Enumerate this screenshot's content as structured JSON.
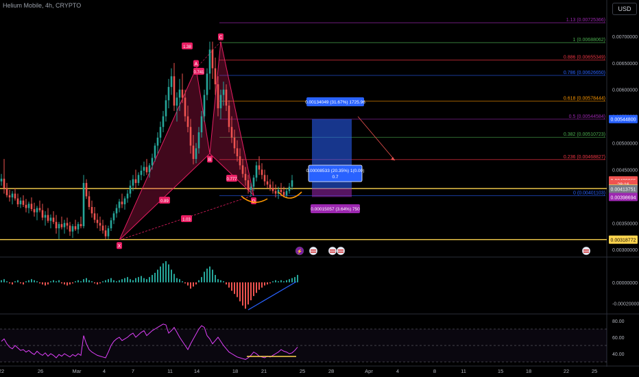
{
  "header": {
    "title": "Helium Mobile, 4h, CRYPTO",
    "currency_button": "USD"
  },
  "colors": {
    "bg": "#000000",
    "up": "#26a69a",
    "down": "#ef5350",
    "pattern": "#e91e63",
    "yellow": "#ffd54f",
    "rsi": "#e040fb",
    "blue": "#2962ff",
    "purple": "#9c27b0"
  },
  "chart_data": [
    {
      "type": "candlestick",
      "title": "Helium Mobile, 4h, CRYPTO",
      "x_ticks": [
        "22",
        "26",
        "Mar",
        "4",
        "7",
        "11",
        "14",
        "18",
        "21",
        "25",
        "28",
        "Apr",
        "4",
        "8",
        "11",
        "15",
        "18",
        "22",
        "25"
      ],
      "y_ticks": [
        "0.00700000",
        "0.00650000",
        "0.00600000",
        "0.00550000",
        "0.00500000",
        "0.00450000",
        "0.00400000",
        "0.00350000",
        "0.00300000"
      ],
      "ylim": [
        0.0029,
        0.0075
      ],
      "candles": [
        [
          0.00428,
          0.00442,
          0.0042,
          0.00433
        ],
        [
          0.00433,
          0.0047,
          0.00405,
          0.00415
        ],
        [
          0.00415,
          0.00425,
          0.00398,
          0.00402
        ],
        [
          0.00402,
          0.00412,
          0.0039,
          0.00398
        ],
        [
          0.00398,
          0.0041,
          0.00385,
          0.00405
        ],
        [
          0.00405,
          0.00415,
          0.00392,
          0.00396
        ],
        [
          0.00396,
          0.00405,
          0.0038,
          0.00385
        ],
        [
          0.00385,
          0.00398,
          0.00378,
          0.00392
        ],
        [
          0.00392,
          0.00402,
          0.0038,
          0.00384
        ],
        [
          0.00384,
          0.00395,
          0.0037,
          0.00378
        ],
        [
          0.00378,
          0.0039,
          0.00368,
          0.00386
        ],
        [
          0.00386,
          0.00398,
          0.00372,
          0.00376
        ],
        [
          0.00376,
          0.00388,
          0.00362,
          0.0037
        ],
        [
          0.0037,
          0.00382,
          0.00355,
          0.00378
        ],
        [
          0.00378,
          0.00392,
          0.0037,
          0.00374
        ],
        [
          0.00374,
          0.00386,
          0.00355,
          0.0036
        ],
        [
          0.0036,
          0.00372,
          0.00345,
          0.00365
        ],
        [
          0.00365,
          0.00378,
          0.0035,
          0.00354
        ],
        [
          0.00354,
          0.00366,
          0.0034,
          0.0036
        ],
        [
          0.0036,
          0.00372,
          0.00348,
          0.00352
        ],
        [
          0.00352,
          0.00365,
          0.0033,
          0.0034
        ],
        [
          0.0034,
          0.00352,
          0.0032,
          0.00348
        ],
        [
          0.00348,
          0.00362,
          0.00338,
          0.00342
        ],
        [
          0.00342,
          0.00356,
          0.0033,
          0.0035
        ],
        [
          0.0035,
          0.0036,
          0.00338,
          0.00345
        ],
        [
          0.00345,
          0.00352,
          0.00326,
          0.00334
        ],
        [
          0.00334,
          0.00348,
          0.00322,
          0.00344
        ],
        [
          0.00344,
          0.00356,
          0.00335,
          0.00338
        ],
        [
          0.00338,
          0.00352,
          0.0033,
          0.00348
        ],
        [
          0.00348,
          0.00362,
          0.0034,
          0.00344
        ],
        [
          0.00344,
          0.0044,
          0.0034,
          0.00425
        ],
        [
          0.00425,
          0.00432,
          0.00395,
          0.004
        ],
        [
          0.004,
          0.0041,
          0.00375,
          0.0038
        ],
        [
          0.0038,
          0.00392,
          0.0036,
          0.00368
        ],
        [
          0.00368,
          0.0038,
          0.0035,
          0.00356
        ],
        [
          0.00356,
          0.00368,
          0.0034,
          0.0035
        ],
        [
          0.0035,
          0.00362,
          0.00335,
          0.00345
        ],
        [
          0.00345,
          0.00356,
          0.0033,
          0.00336
        ],
        [
          0.00336,
          0.00346,
          0.0032,
          0.00325
        ],
        [
          0.00325,
          0.00345,
          0.0032,
          0.0034
        ],
        [
          0.0034,
          0.0036,
          0.00335,
          0.00355
        ],
        [
          0.00355,
          0.00372,
          0.00348,
          0.00368
        ],
        [
          0.00368,
          0.00385,
          0.0036,
          0.00378
        ],
        [
          0.00378,
          0.00395,
          0.0037,
          0.0039
        ],
        [
          0.0039,
          0.00405,
          0.00378,
          0.00385
        ],
        [
          0.00385,
          0.004,
          0.00375,
          0.00396
        ],
        [
          0.00396,
          0.00412,
          0.00388,
          0.00405
        ],
        [
          0.00405,
          0.0043,
          0.00398,
          0.0042
        ],
        [
          0.0042,
          0.0044,
          0.0041,
          0.00432
        ],
        [
          0.00432,
          0.0045,
          0.00415,
          0.00425
        ],
        [
          0.00425,
          0.00445,
          0.0042,
          0.0044
        ],
        [
          0.0044,
          0.00458,
          0.0043,
          0.00448
        ],
        [
          0.00448,
          0.00465,
          0.00438,
          0.00455
        ],
        [
          0.00455,
          0.0047,
          0.0044,
          0.00445
        ],
        [
          0.00445,
          0.00462,
          0.00435,
          0.00458
        ],
        [
          0.00458,
          0.0048,
          0.0045,
          0.00472
        ],
        [
          0.00472,
          0.005,
          0.00465,
          0.00495
        ],
        [
          0.00495,
          0.0052,
          0.0048,
          0.0051
        ],
        [
          0.0051,
          0.0054,
          0.005,
          0.0053
        ],
        [
          0.0053,
          0.0056,
          0.0052,
          0.0055
        ],
        [
          0.0055,
          0.0059,
          0.0054,
          0.0058
        ],
        [
          0.0058,
          0.0062,
          0.00565,
          0.00605
        ],
        [
          0.00605,
          0.0064,
          0.0059,
          0.00625
        ],
        [
          0.00625,
          0.0065,
          0.0056,
          0.0057
        ],
        [
          0.0057,
          0.00595,
          0.0054,
          0.00585
        ],
        [
          0.00585,
          0.0062,
          0.0056,
          0.006
        ],
        [
          0.006,
          0.0063,
          0.00575,
          0.00585
        ],
        [
          0.00585,
          0.006,
          0.0054,
          0.0055
        ],
        [
          0.0055,
          0.0057,
          0.0052,
          0.0053
        ],
        [
          0.0053,
          0.00545,
          0.0048,
          0.00495
        ],
        [
          0.00495,
          0.00515,
          0.0046,
          0.0047
        ],
        [
          0.0047,
          0.005,
          0.00462,
          0.0049
        ],
        [
          0.0049,
          0.0053,
          0.0048,
          0.0052
        ],
        [
          0.0052,
          0.0056,
          0.0051,
          0.0055
        ],
        [
          0.0055,
          0.006,
          0.0054,
          0.0059
        ],
        [
          0.0059,
          0.0064,
          0.0058,
          0.0063
        ],
        [
          0.0063,
          0.0069,
          0.006,
          0.00675
        ],
        [
          0.00675,
          0.0069,
          0.0062,
          0.0064
        ],
        [
          0.0064,
          0.0066,
          0.0059,
          0.0061
        ],
        [
          0.0061,
          0.00625,
          0.0055,
          0.00565
        ],
        [
          0.00565,
          0.006,
          0.00545,
          0.0059
        ],
        [
          0.0059,
          0.00615,
          0.0057,
          0.006
        ],
        [
          0.006,
          0.0061,
          0.0056,
          0.0057
        ],
        [
          0.0057,
          0.0058,
          0.0052,
          0.0053
        ],
        [
          0.0053,
          0.0055,
          0.005,
          0.0051
        ],
        [
          0.0051,
          0.00525,
          0.0048,
          0.0049
        ],
        [
          0.0049,
          0.00505,
          0.00465,
          0.00475
        ],
        [
          0.00475,
          0.0049,
          0.0045,
          0.00458
        ],
        [
          0.00458,
          0.0047,
          0.00435,
          0.00442
        ],
        [
          0.00442,
          0.00455,
          0.0042,
          0.0043
        ],
        [
          0.0043,
          0.0044,
          0.00405,
          0.00412
        ],
        [
          0.00412,
          0.00425,
          0.004,
          0.00418
        ],
        [
          0.00418,
          0.0044,
          0.0041,
          0.00435
        ],
        [
          0.00435,
          0.00465,
          0.00428,
          0.00458
        ],
        [
          0.00458,
          0.00475,
          0.0044,
          0.0045
        ],
        [
          0.0045,
          0.00462,
          0.00432,
          0.0044
        ],
        [
          0.0044,
          0.0045,
          0.0042,
          0.00428
        ],
        [
          0.00428,
          0.0044,
          0.00415,
          0.00422
        ],
        [
          0.00422,
          0.00432,
          0.0041,
          0.00416
        ],
        [
          0.00416,
          0.00428,
          0.00405,
          0.0041
        ],
        [
          0.0041,
          0.00422,
          0.00398,
          0.00405
        ],
        [
          0.00405,
          0.00418,
          0.00395,
          0.00412
        ],
        [
          0.00412,
          0.00425,
          0.004,
          0.00408
        ],
        [
          0.00408,
          0.00418,
          0.00398,
          0.00402
        ],
        [
          0.00402,
          0.00415,
          0.00398,
          0.0041
        ],
        [
          0.0041,
          0.00425,
          0.00405,
          0.00418
        ],
        [
          0.00418,
          0.0044,
          0.00412,
          0.0043
        ]
      ],
      "fib_levels": [
        {
          "label": "1.13 (0.00725366)",
          "value": 0.00725366,
          "color": "#9c27b0"
        },
        {
          "label": "1 (0.00688062)",
          "value": 0.00688062,
          "color": "#4caf50"
        },
        {
          "label": "0.886 (0.00655349)",
          "value": 0.00655349,
          "color": "#f23645"
        },
        {
          "label": "0.786 (0.00626650)",
          "value": 0.0062665,
          "color": "#2962ff"
        },
        {
          "label": "0.618 (0.00578444)",
          "value": 0.00578444,
          "color": "#ff9800"
        },
        {
          "label": "0.5 (0.00544584)",
          "value": 0.00544584,
          "color": "#9c27b0"
        },
        {
          "label": "0.382 (0.00510723)",
          "value": 0.00510723,
          "color": "#4caf50"
        },
        {
          "label": "0.236 (0.00468827)",
          "value": 0.00468827,
          "color": "#f23645"
        },
        {
          "label": "0 (0.00401103)",
          "value": 0.00401103,
          "color": "#2962ff"
        }
      ],
      "horizontal_levels": [
        0.00414575,
        0.00318772
      ],
      "pattern_points": [
        {
          "label": "X",
          "value": 0.00318
        },
        {
          "label": "A",
          "value": 0.0064
        },
        {
          "label": "B",
          "value": 0.0048
        },
        {
          "label": "C",
          "value": 0.0069
        },
        {
          "label": "D",
          "value": 0.00402
        }
      ],
      "pattern_ratio_labels": [
        "1.03",
        "0.89",
        "0.777",
        "1.38",
        "0.741"
      ],
      "position_tool": {
        "target_label": "0.00134049 (31.67%) 1725.96",
        "entry_label": "0.00008533 (20.35%) 1(0.00)",
        "entry_sub": "0.7",
        "stop_label": "0.00015057 (3.64%) 750"
      },
      "price_labels": [
        {
          "text": "0.00544800",
          "bg": "#2962ff",
          "value": 0.005448
        },
        {
          "text": "0.00429865",
          "bg": "#ef5350",
          "value": 0.00429865
        },
        {
          "text": "28:16",
          "bg": "#ef5350",
          "value": 0.00423
        },
        {
          "text": "0.00414575",
          "bg": "#ffd54f",
          "value": 0.00414575
        },
        {
          "text": "0.00413751",
          "bg": "#787b86",
          "value": 0.00413751
        },
        {
          "text": "0.00398694",
          "bg": "#9c27b0",
          "value": 0.00398694
        },
        {
          "text": "0.00318772",
          "bg": "#ffd54f",
          "value": 0.00318772
        }
      ]
    },
    {
      "type": "bar",
      "title": "",
      "y_ticks": [
        "0.00000000",
        "-0.00020000"
      ],
      "ylim": [
        -0.00028,
        0.00022
      ],
      "values": [
        2e-05,
        3e-05,
        1e-05,
        -1e-05,
        -2e-05,
        1e-05,
        2e-05,
        -1e-05,
        -2e-05,
        1e-05,
        2e-05,
        3e-05,
        2e-05,
        1e-05,
        -1e-05,
        -2e-05,
        -3e-05,
        -2e-05,
        1e-05,
        2e-05,
        1e-05,
        2e-05,
        -1e-05,
        -2e-05,
        -3e-05,
        -2e-05,
        -1e-05,
        1e-05,
        2e-05,
        1e-05,
        3e-05,
        4e-05,
        2e-05,
        1e-05,
        -1e-05,
        -2e-05,
        -1e-05,
        1e-05,
        2e-05,
        3e-05,
        4e-05,
        2e-05,
        1e-05,
        2e-05,
        3e-05,
        4e-05,
        5e-05,
        3e-05,
        2e-05,
        4e-05,
        5e-05,
        6e-05,
        4e-05,
        3e-05,
        5e-05,
        7e-05,
        9e-05,
        0.00012,
        0.00015,
        0.00018,
        0.0002,
        0.00017,
        0.00012,
        8e-05,
        4e-05,
        3e-05,
        1e-05,
        -1e-05,
        -3e-05,
        -6e-05,
        -4e-05,
        -2e-05,
        2e-05,
        5e-05,
        0.0001,
        0.00013,
        0.00015,
        0.00012,
        7e-05,
        3e-05,
        2e-05,
        1e-05,
        -2e-05,
        -5e-05,
        -8e-05,
        -0.00011,
        -0.00014,
        -0.00018,
        -0.00022,
        -0.00025,
        -0.00021,
        -0.00017,
        -0.00013,
        -0.0001,
        -7e-05,
        -5e-05,
        -3e-05,
        -2e-05,
        -1e-05,
        1e-05,
        2e-05,
        1e-05,
        2e-05,
        1e-05,
        2e-05,
        3e-05,
        4e-05,
        5e-05,
        7e-05
      ]
    },
    {
      "type": "line",
      "title": "",
      "y_ticks": [
        "80.00",
        "60.00",
        "40.00"
      ],
      "ylim": [
        30,
        85
      ],
      "values": [
        55,
        58,
        52,
        48,
        46,
        50,
        47,
        44,
        45,
        42,
        44,
        41,
        39,
        43,
        40,
        38,
        41,
        37,
        40,
        38,
        35,
        39,
        37,
        40,
        38,
        36,
        39,
        37,
        40,
        38,
        62,
        52,
        45,
        42,
        40,
        38,
        37,
        36,
        35,
        42,
        50,
        55,
        58,
        60,
        56,
        58,
        60,
        63,
        65,
        60,
        63,
        66,
        68,
        62,
        65,
        68,
        70,
        72,
        74,
        76,
        75,
        65,
        68,
        72,
        66,
        60,
        55,
        50,
        45,
        52,
        58,
        64,
        70,
        74,
        72,
        62,
        58,
        52,
        56,
        60,
        55,
        50,
        46,
        42,
        40,
        38,
        36,
        35,
        34,
        33,
        35,
        38,
        42,
        40,
        37,
        36,
        35,
        37,
        36,
        38,
        40,
        42,
        45,
        43,
        42,
        40,
        41,
        44,
        48
      ]
    }
  ]
}
